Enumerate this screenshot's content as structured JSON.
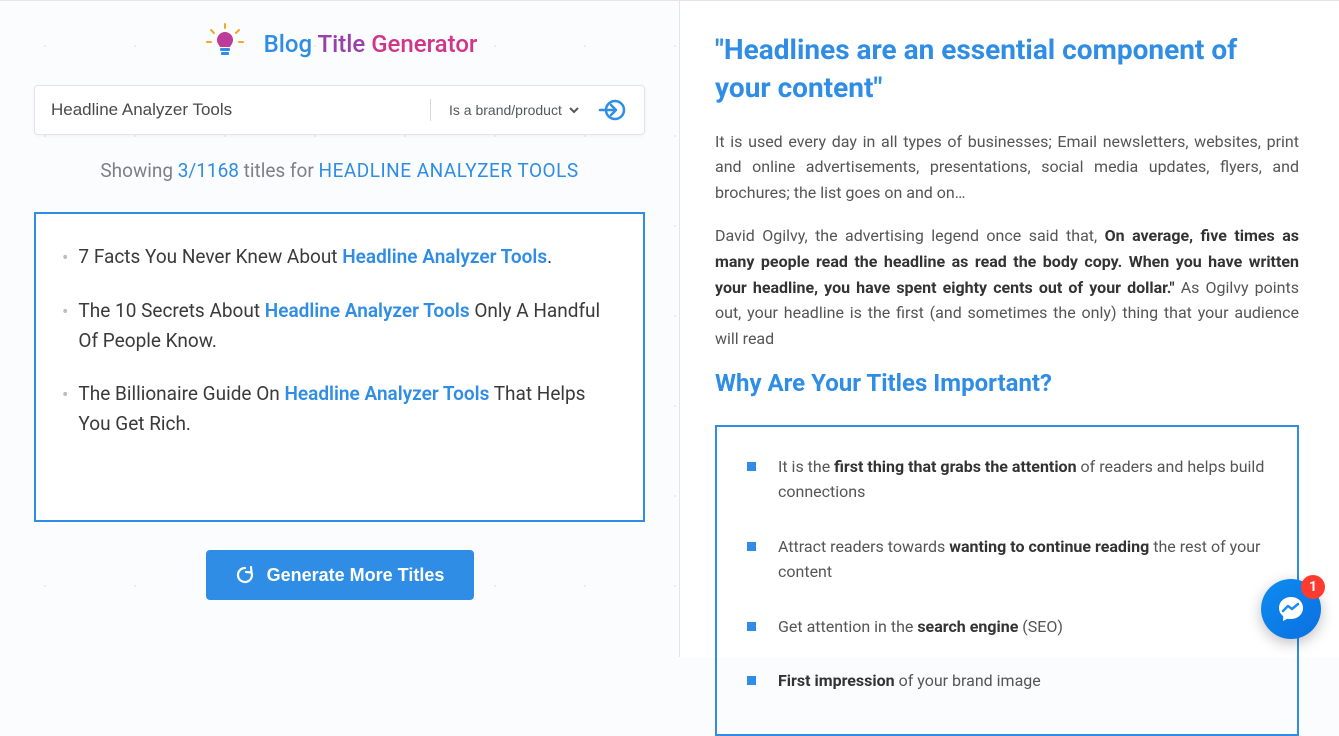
{
  "header": {
    "title_blog": "Blog",
    "title_title": "Title",
    "title_gen": "Generator"
  },
  "form": {
    "input_value": "Headline Analyzer Tools",
    "select_value": "Is a brand/product"
  },
  "showing": {
    "prefix": "Showing ",
    "count": "3/1168",
    "mid": " titles for ",
    "term": "HEADLINE ANALYZER TOOLS"
  },
  "results": [
    {
      "pre": "7 Facts You Never Knew About ",
      "hl": "Headline Analyzer Tools",
      "post": "."
    },
    {
      "pre": "The 10 Secrets About ",
      "hl": "Headline Analyzer Tools",
      "post": " Only A Handful Of People Know."
    },
    {
      "pre": "The Billionaire Guide On ",
      "hl": "Headline Analyzer Tools",
      "post": " That Helps You Get Rich."
    }
  ],
  "generate_button": "Generate More Titles",
  "right": {
    "quote": "\"Headlines are an essential component of your content\"",
    "para1": "It is used every day in all types of businesses; Email newsletters, websites, print and online advertisements, presentations, social media updates, flyers, and brochures; the list goes on and on…",
    "para2_pre": "David Ogilvy, the advertising legend once said that, ",
    "para2_bold": "On average, five times as many people read the headline as read the body copy. When you have written your headline, you have spent eighty cents out of your dollar.\"",
    "para2_post": " As Ogilvy points out, your headline is the first (and sometimes the only) thing that your audience will read",
    "h2": "Why Are Your Titles Important?",
    "bullets": [
      {
        "pre": "It is the ",
        "b": "first thing that grabs the attention",
        "post": " of readers and helps build connections"
      },
      {
        "pre": "Attract readers towards ",
        "b": "wanting to continue reading",
        "post": " the rest of your content"
      },
      {
        "pre": "Get attention in the ",
        "b": "search engine",
        "post": " (SEO)"
      },
      {
        "pre": "",
        "b": "First impression",
        "post": " of your brand image"
      }
    ]
  },
  "messenger_badge": "1"
}
